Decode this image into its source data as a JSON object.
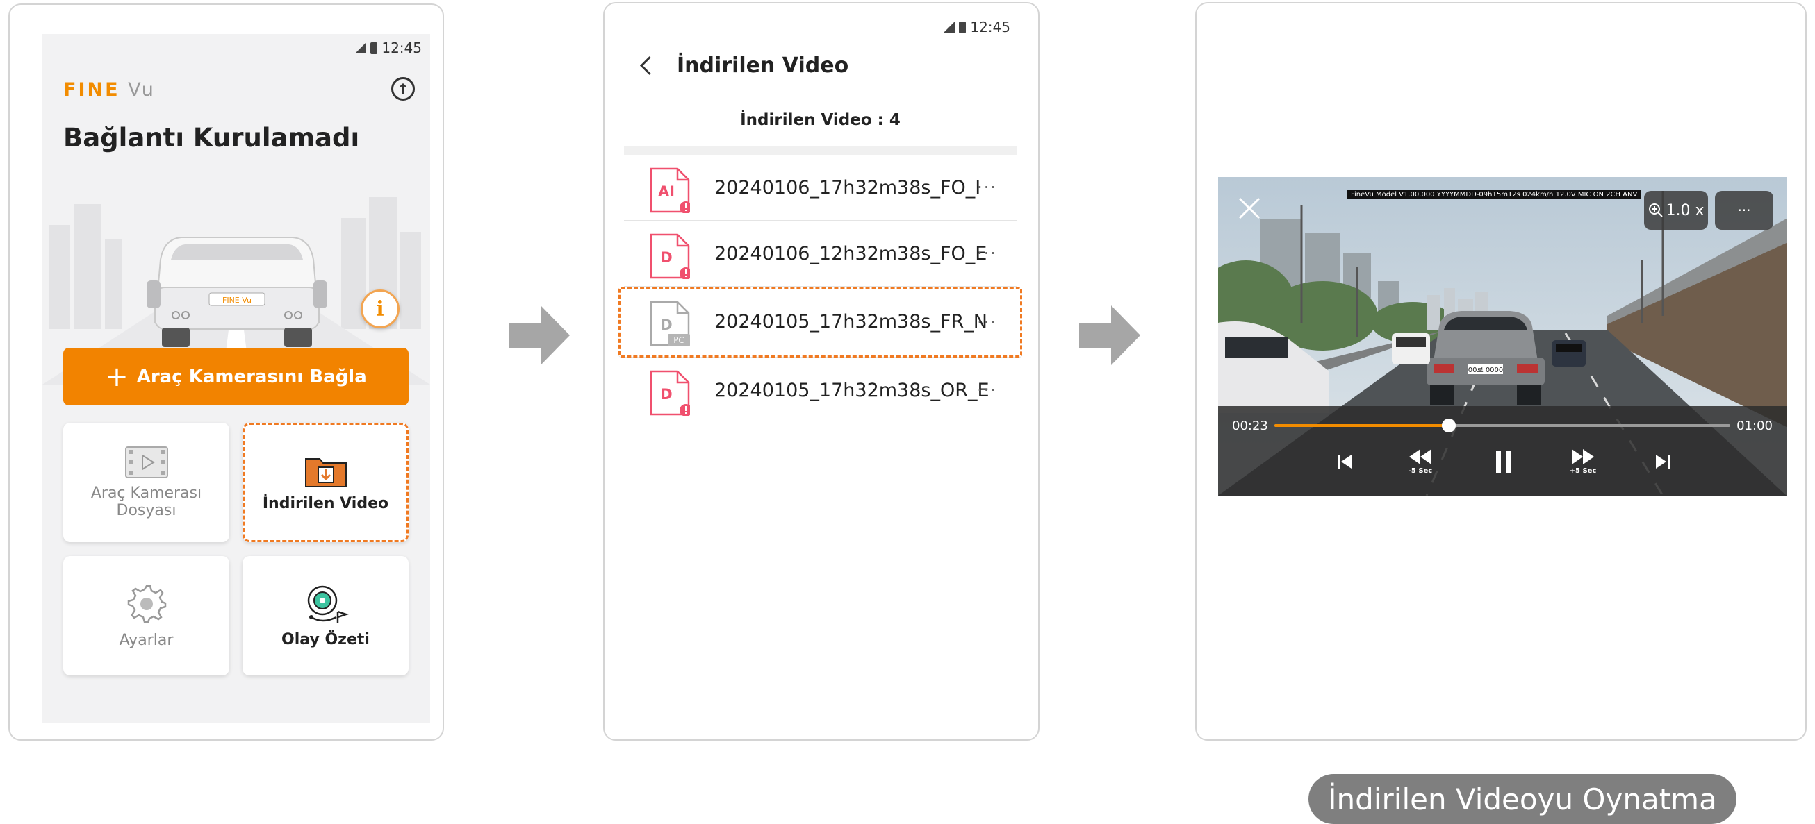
{
  "screen1": {
    "status_time": "12:45",
    "logo_fine": "FINE",
    "logo_vu": "Vu",
    "title": "Bağlantı Kurulamadı",
    "car_plate": "FINE Vu",
    "connect_plus": "+",
    "connect_label": "Araç Kamerasını Bağla",
    "tiles": {
      "dashcam_file_line1": "Araç Kamerası",
      "dashcam_file_line2": "Dosyası",
      "downloaded_video": "İndirilen Video",
      "settings": "Ayarlar",
      "event_summary": "Olay Özeti"
    },
    "icons": [
      "signal-icon",
      "battery-icon",
      "upload-icon",
      "info-icon",
      "film-icon",
      "download-folder-icon",
      "gear-icon",
      "event-summary-icon"
    ]
  },
  "screen2": {
    "status_time": "12:45",
    "title": "İndirilen Video",
    "count_label": "İndirilen Video : 4",
    "files": [
      {
        "badge": "AI",
        "name": "20240106_17h32m38s_FO_I",
        "warning": true,
        "source": ""
      },
      {
        "badge": "D",
        "name": "20240106_12h32m38s_FO_E",
        "warning": true,
        "source": ""
      },
      {
        "badge": "D",
        "name": "20240105_17h32m38s_FR_N",
        "warning": false,
        "source": "PC"
      },
      {
        "badge": "D",
        "name": "20240105_17h32m38s_OR_E",
        "warning": true,
        "source": ""
      }
    ],
    "more_glyph": "···"
  },
  "screen3": {
    "osd_text": "FineVu Model V1.00.000 YYYYMMDD-09h15m12s 024km/h 12.0V MIC ON 2CH ANV",
    "zoom_label": "1.0 x",
    "more_glyph": "···",
    "elapsed": "00:23",
    "duration": "01:00",
    "progress": 0.383,
    "rewind_sub": "-5 Sec",
    "forward_sub": "+5 Sec",
    "plate": "00로 0000"
  },
  "caption": "İndirilen Videoyu Oynatma",
  "colors": {
    "accent": "#f28300",
    "warning": "#f0506e",
    "dashed": "#f07a22",
    "caption_bg": "#7f7f7f"
  }
}
